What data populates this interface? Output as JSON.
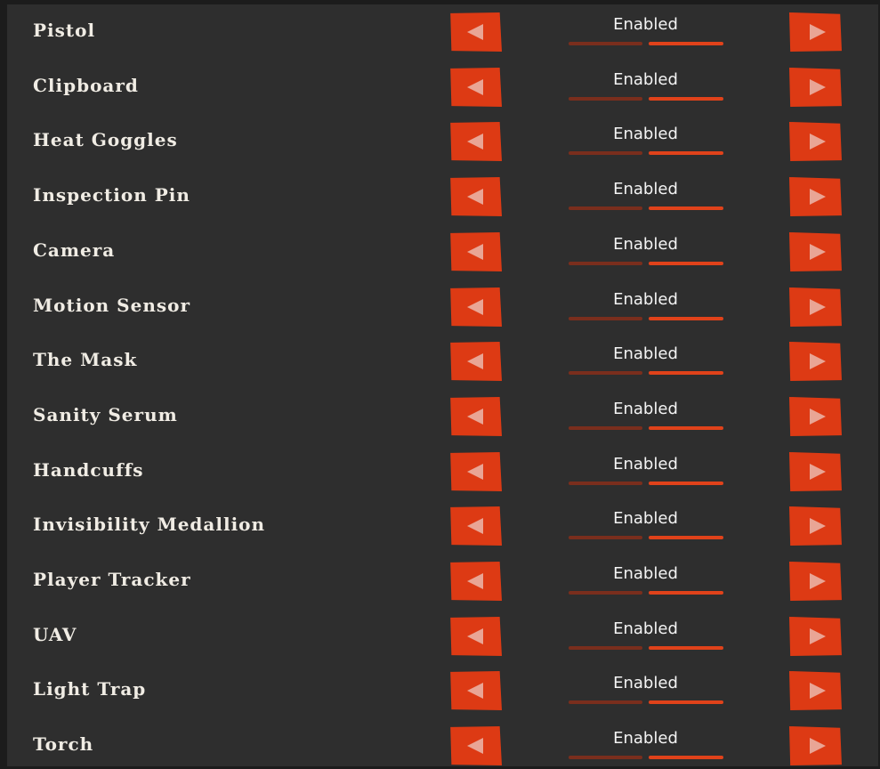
{
  "items": [
    {
      "label": "Pistol",
      "value": "Enabled"
    },
    {
      "label": "Clipboard",
      "value": "Enabled"
    },
    {
      "label": "Heat Goggles",
      "value": "Enabled"
    },
    {
      "label": "Inspection Pin",
      "value": "Enabled"
    },
    {
      "label": "Camera",
      "value": "Enabled"
    },
    {
      "label": "Motion Sensor",
      "value": "Enabled"
    },
    {
      "label": "The Mask",
      "value": "Enabled"
    },
    {
      "label": "Sanity Serum",
      "value": "Enabled"
    },
    {
      "label": "Handcuffs",
      "value": "Enabled"
    },
    {
      "label": "Invisibility Medallion",
      "value": "Enabled"
    },
    {
      "label": "Player Tracker",
      "value": "Enabled"
    },
    {
      "label": "UAV",
      "value": "Enabled"
    },
    {
      "label": "Light Trap",
      "value": "Enabled"
    },
    {
      "label": "Torch",
      "value": "Enabled"
    }
  ],
  "icons": {
    "left_arrow": "triangle-left-icon",
    "right_arrow": "triangle-right-icon"
  },
  "colors": {
    "panel_background": "#2e2e2e",
    "button": "#dd3a14",
    "arrow_glyph": "#e9a595",
    "segment_active": "#e0421a",
    "segment_inactive": "#7a2e1d",
    "label_text": "#f0ece4"
  }
}
